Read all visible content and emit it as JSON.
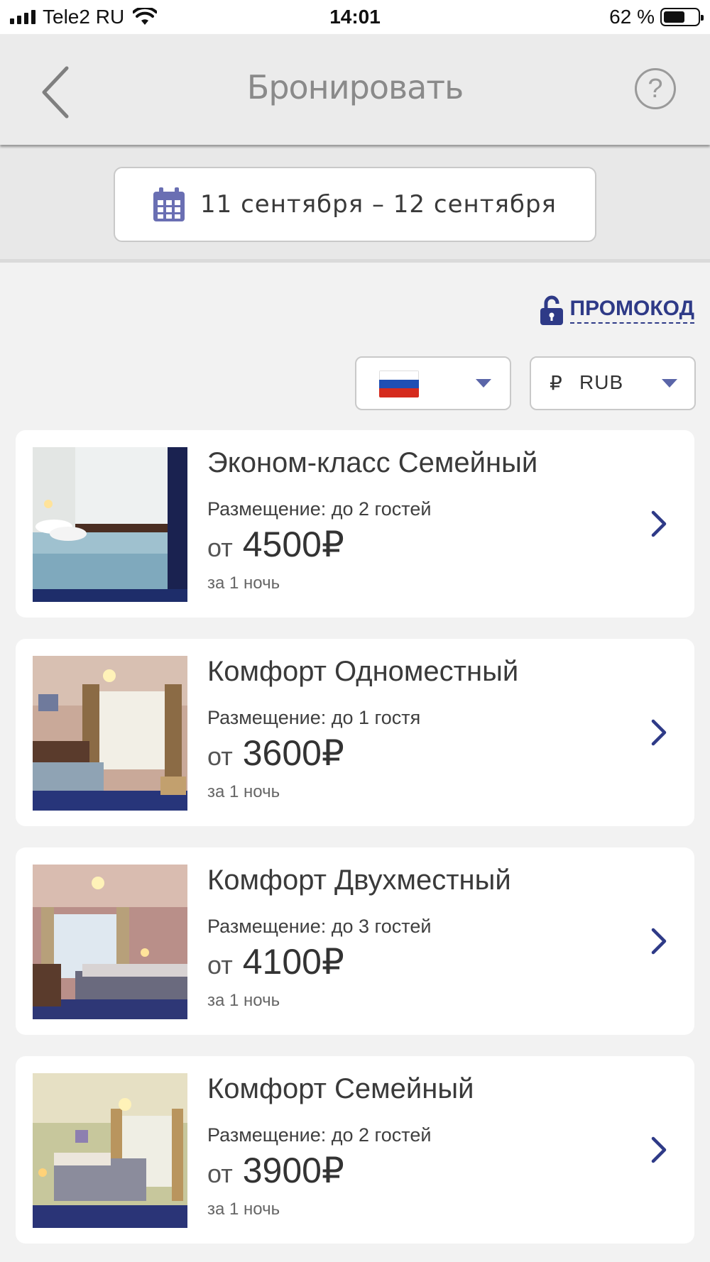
{
  "status_bar": {
    "carrier": "Tele2 RU",
    "time": "14:01",
    "battery": "62 %",
    "battery_level": 0.62,
    "icons": [
      "signal-icon",
      "wifi-icon",
      "battery-icon"
    ]
  },
  "header": {
    "title": "Бронировать",
    "back_icon": "chevron-left-icon",
    "help_label": "?"
  },
  "date_range": {
    "icon": "calendar-icon",
    "label": "11 сентября – 12 сентября"
  },
  "promo": {
    "icon": "lock-icon",
    "label": "ПРОМОКОД"
  },
  "filters": {
    "language": {
      "selected": "ru-flag-icon",
      "flag_colors": [
        "#ffffff",
        "#1f4fb4",
        "#d52b1e"
      ]
    },
    "currency": {
      "symbol": "₽",
      "selected": "RUB"
    }
  },
  "rooms": [
    {
      "name": "Эконом-класс Семейный",
      "capacity": "Размещение: до 2 гостей",
      "from": "от",
      "price": "4500₽",
      "per_night": "за 1 ночь"
    },
    {
      "name": "Комфорт Одноместный",
      "capacity": "Размещение: до 1 гостя",
      "from": "от",
      "price": "3600₽",
      "per_night": "за 1 ночь"
    },
    {
      "name": "Комфорт Двухместный",
      "capacity": "Размещение: до 3 гостей",
      "from": "от",
      "price": "4100₽",
      "per_night": "за 1 ночь"
    },
    {
      "name": "Комфорт Семейный",
      "capacity": "Размещение: до 2 гостей",
      "from": "от",
      "price": "3900₽",
      "per_night": "за 1 ночь"
    }
  ],
  "colors": {
    "accent": "#2e3a87",
    "caret": "#5a65a8",
    "calendar": "#6a6fb3",
    "header_bg": "#ebebeb",
    "page_bg": "#f2f2f2"
  }
}
